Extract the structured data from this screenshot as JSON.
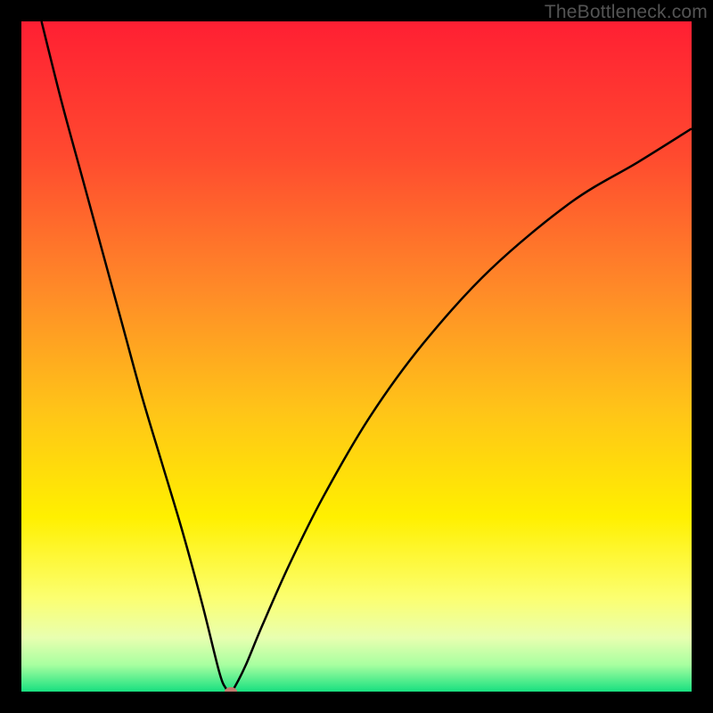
{
  "watermark": {
    "text": "TheBottleneck.com"
  },
  "colors": {
    "black": "#000000",
    "curve": "#000000",
    "marker": "#C07A6E",
    "gradient_stops": [
      {
        "pos": 0.0,
        "color": "#FF1F33"
      },
      {
        "pos": 0.2,
        "color": "#FF4A2F"
      },
      {
        "pos": 0.4,
        "color": "#FF8A28"
      },
      {
        "pos": 0.58,
        "color": "#FFC418"
      },
      {
        "pos": 0.74,
        "color": "#FFF000"
      },
      {
        "pos": 0.86,
        "color": "#FCFF70"
      },
      {
        "pos": 0.92,
        "color": "#E8FFB0"
      },
      {
        "pos": 0.96,
        "color": "#A8FFA0"
      },
      {
        "pos": 1.0,
        "color": "#18E080"
      }
    ]
  },
  "chart_data": {
    "type": "line",
    "title": "",
    "xlabel": "",
    "ylabel": "",
    "xlim": [
      0,
      100
    ],
    "ylim": [
      0,
      100
    ],
    "grid": false,
    "legend": false,
    "series": [
      {
        "name": "bottleneck-curve",
        "x": [
          3,
          6,
          9,
          12,
          15,
          18,
          21,
          24,
          27,
          29.5,
          30.5,
          31.25,
          32,
          33.5,
          36,
          40,
          45,
          52,
          60,
          70,
          82,
          92,
          100
        ],
        "y": [
          100,
          88,
          77,
          66,
          55,
          44,
          34,
          24,
          13,
          3,
          0.5,
          0,
          1,
          4,
          10,
          19,
          29,
          41,
          52,
          63,
          73,
          79,
          84
        ]
      }
    ],
    "annotations": [
      {
        "type": "marker",
        "x": 31.25,
        "y": 0,
        "name": "minimum-point"
      }
    ]
  }
}
